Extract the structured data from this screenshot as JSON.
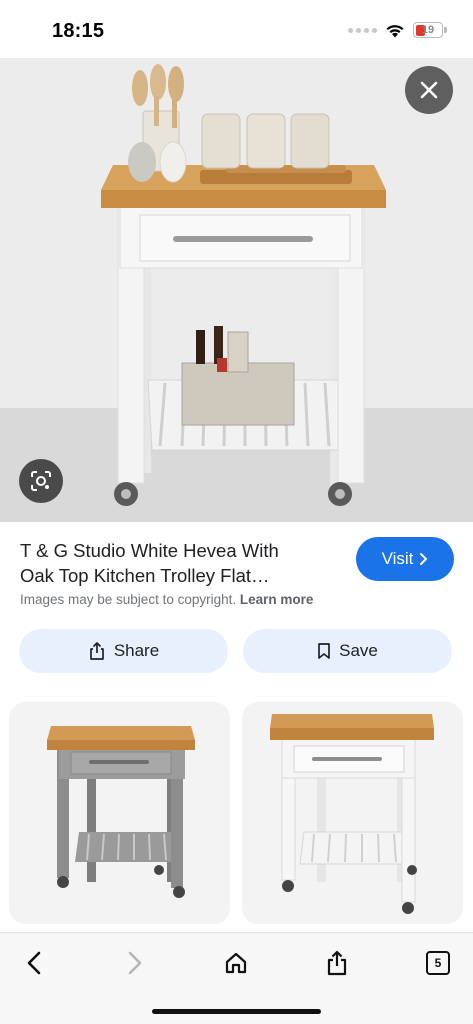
{
  "status_bar": {
    "time": "18:15",
    "battery": "19"
  },
  "result": {
    "title_line1": "T & G Studio White Hevea With",
    "title_line2": "Oak Top Kitchen Trolley Flat…",
    "visit_label": "Visit",
    "copyright_text": "Images may be subject to copyright.",
    "learn_more": "Learn more",
    "share_label": "Share",
    "save_label": "Save"
  },
  "toolbar": {
    "tabs_count": "5"
  },
  "colors": {
    "accent": "#1a73e8",
    "pill_bg": "#e8f0fe",
    "battery_low": "#e0382f"
  },
  "icons": [
    "close-icon",
    "lens-icon",
    "chevron-right-icon",
    "share-icon",
    "bookmark-icon",
    "back-icon",
    "forward-icon",
    "home-icon",
    "tabs-icon"
  ]
}
